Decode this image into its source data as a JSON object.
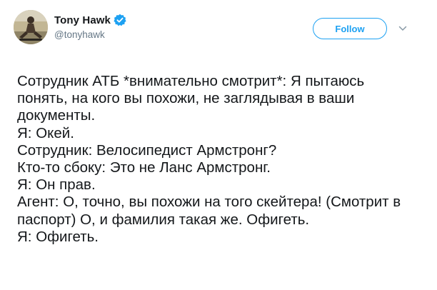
{
  "user": {
    "display_name": "Tony Hawk",
    "handle": "@tonyhawk",
    "verified": true
  },
  "follow_button": {
    "label": "Follow"
  },
  "icons": {
    "verified": "verified-badge-icon",
    "caret": "chevron-down-icon"
  },
  "colors": {
    "accent": "#1da1f2",
    "text": "#14171a",
    "secondary_text": "#657786"
  },
  "tweet": {
    "lines": [
      "Сотрудник АТБ *внимательно смотрит*: Я пытаюсь",
      "понять, на кого вы похожи, не заглядывая в ваши",
      "документы.",
      "Я: Окей.",
      "Сотрудник: Велосипедист Армстронг?",
      "Кто-то сбоку: Это не Ланс Армстронг.",
      "Я: Он прав.",
      "Агент: О, точно, вы похожи на того скейтера! (Смотрит в",
      "паспорт) О, и фамилия такая же. Офигеть.",
      "Я: Офигеть."
    ]
  }
}
